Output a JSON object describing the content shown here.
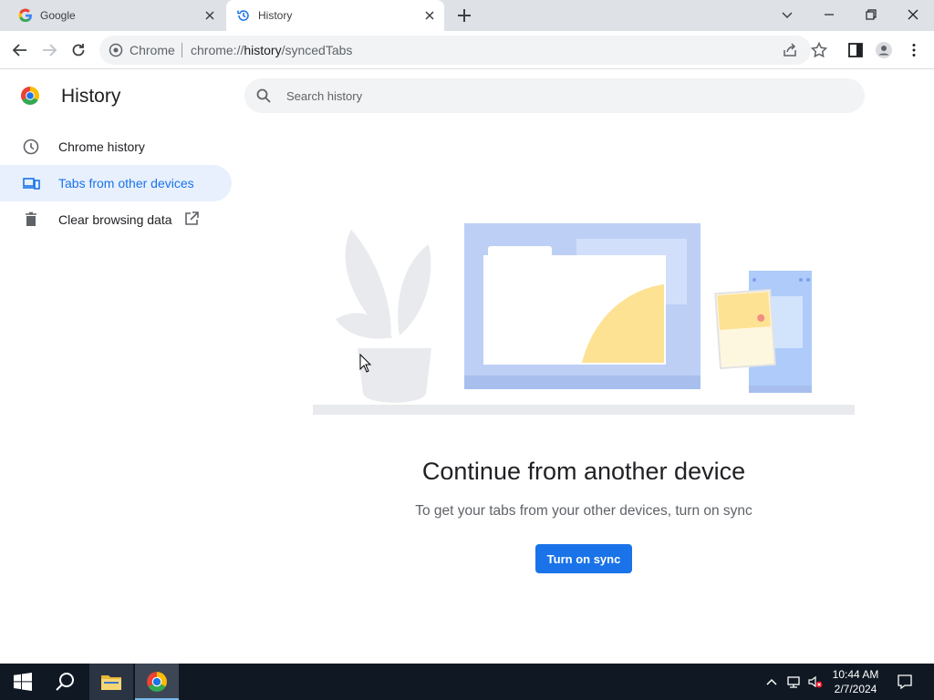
{
  "tabs": [
    {
      "label": "Google",
      "active": false
    },
    {
      "label": "History",
      "active": true
    }
  ],
  "toolbar": {
    "site_chip": "Chrome",
    "url_prefix": "chrome://",
    "url_host": "history",
    "url_path": "/syncedTabs"
  },
  "sidebar": {
    "title": "History",
    "items": [
      {
        "label": "Chrome history",
        "icon": "clock-icon"
      },
      {
        "label": "Tabs from other devices",
        "icon": "devices-icon",
        "selected": true
      },
      {
        "label": "Clear browsing data",
        "icon": "trash-icon",
        "external": true
      }
    ]
  },
  "search": {
    "placeholder": "Search history"
  },
  "main": {
    "heading": "Continue from another device",
    "subtext": "To get your tabs from your other devices, turn on sync",
    "button": "Turn on sync"
  },
  "taskbar": {
    "time": "10:44 AM",
    "date": "2/7/2024"
  },
  "colors": {
    "accent": "#1a73e8",
    "selected_bg": "#e8f0fe",
    "taskbar": "#101923"
  }
}
